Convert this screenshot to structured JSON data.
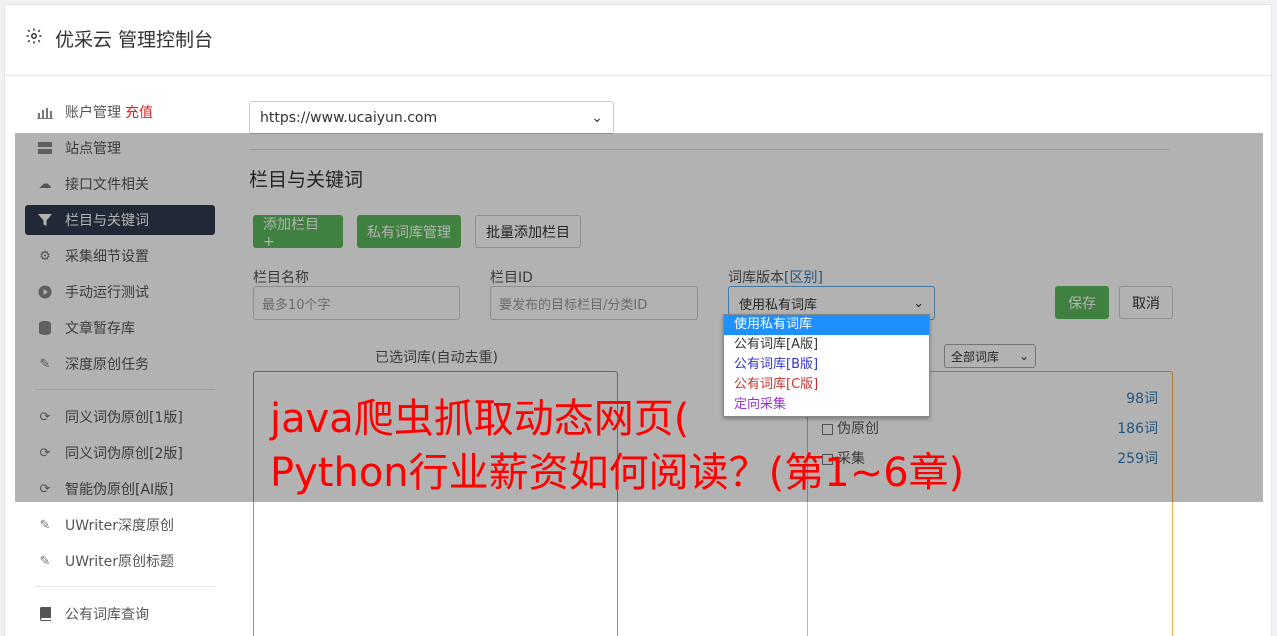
{
  "header": {
    "title": "优采云 管理控制台"
  },
  "sidebar": {
    "items": [
      {
        "label": "账户管理",
        "badge": "充值",
        "icon": "bar-chart-icon"
      },
      {
        "label": "站点管理",
        "icon": "server-icon"
      },
      {
        "label": "接口文件相关",
        "icon": "cloud-upload-icon"
      },
      {
        "label": "栏目与关键词",
        "icon": "filter-icon",
        "active": true
      },
      {
        "label": "采集细节设置",
        "icon": "cogs-icon"
      },
      {
        "label": "手动运行测试",
        "icon": "play-circle-icon"
      },
      {
        "label": "文章暂存库",
        "icon": "database-icon"
      },
      {
        "label": "深度原创任务",
        "icon": "edit-icon"
      },
      {
        "label": "同义词伪原创[1版]",
        "icon": "refresh-icon"
      },
      {
        "label": "同义词伪原创[2版]",
        "icon": "refresh-icon"
      },
      {
        "label": "智能伪原创[AI版]",
        "icon": "refresh-icon"
      },
      {
        "label": "UWriter深度原创",
        "icon": "edit-icon"
      },
      {
        "label": "UWriter原创标题",
        "icon": "edit-icon"
      },
      {
        "label": "公有词库查询",
        "icon": "book-icon"
      }
    ]
  },
  "main": {
    "site_select_value": "https://www.ucaiyun.com",
    "section_title": "栏目与关键词",
    "buttons": {
      "add_column": "添加栏目 +",
      "private_lib": "私有词库管理",
      "batch_add": "批量添加栏目",
      "save": "保存",
      "cancel": "取消"
    },
    "fields": {
      "column_name_label": "栏目名称",
      "column_name_placeholder": "最多10个字",
      "column_id_label": "栏目ID",
      "column_id_placeholder": "要发布的目标栏目/分类ID",
      "lib_version_label": "词库版本",
      "lib_version_link": "[区别]",
      "lib_version_value": "使用私有词库"
    },
    "dropdown_options": [
      {
        "label": "使用私有词库",
        "color": "#ffffff"
      },
      {
        "label": "公有词库[A版]",
        "color": "#333333"
      },
      {
        "label": "公有词库[B版]",
        "color": "#3333cc"
      },
      {
        "label": "公有词库[C版]",
        "color": "#cc3333"
      },
      {
        "label": "定向采集",
        "color": "#9933cc"
      }
    ],
    "selected_panel_title": "已选词库(自动去重)",
    "filter_value": "全部词库",
    "libraries": [
      {
        "name": "",
        "count": "98词"
      },
      {
        "name": "伪原创",
        "count": "186词"
      },
      {
        "name": "采集",
        "count": "259词"
      }
    ]
  },
  "banner": {
    "line1": "java爬虫抓取动态网页(",
    "line2": "Python行业薪资如何阅读？(第1~6章)"
  },
  "colors": {
    "accent_green": "#5cb85c",
    "nav_active": "#2f3c4c",
    "banner_red": "#ff0000"
  }
}
